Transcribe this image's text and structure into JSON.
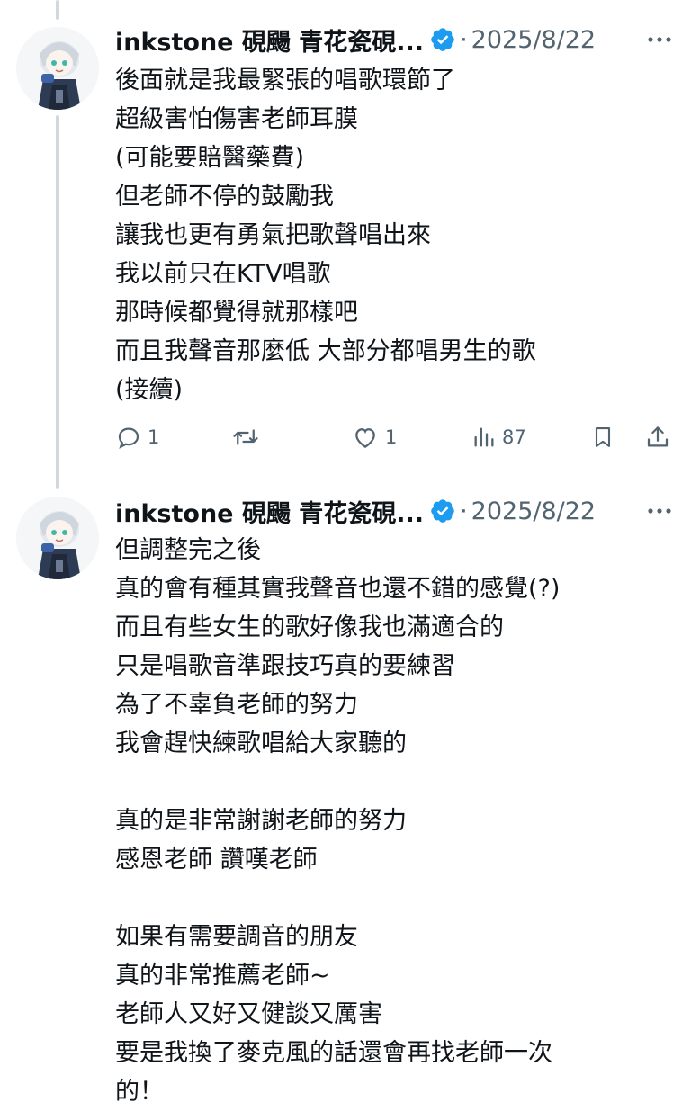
{
  "tweets": [
    {
      "name": "inkstone 硯颺 青花瓷硯...",
      "separator": "·",
      "date": "2025/8/22",
      "text": "後面就是我最緊張的唱歌環節了\n超級害怕傷害老師耳膜\n(可能要賠醫藥費)\n但老師不停的鼓勵我\n讓我也更有勇氣把歌聲唱出來\n我以前只在KTV唱歌\n那時候都覺得就那樣吧\n而且我聲音那麼低 大部分都唱男生的歌\n(接續)",
      "actions": {
        "replies": "1",
        "reposts": "",
        "likes": "1",
        "views": "87"
      }
    },
    {
      "name": "inkstone 硯颺 青花瓷硯...",
      "separator": "·",
      "date": "2025/8/22",
      "text": "但調整完之後\n真的會有種其實我聲音也還不錯的感覺(?)\n而且有些女生的歌好像我也滿適合的\n只是唱歌音準跟技巧真的要練習\n為了不辜負老師的努力\n我會趕快練歌唱給大家聽的\n\n真的是非常謝謝老師的努力\n感恩老師 讚嘆老師\n\n如果有需要調音的朋友\n真的非常推薦老師~\n老師人又好又健談又厲害\n要是我換了麥克風的話還會再找老師一次\n的！"
    }
  ],
  "colors": {
    "text": "#0f1419",
    "secondary": "#536471",
    "verified": "#1d9bf0",
    "thread_line": "#cfd9de"
  },
  "icons": [
    "reply-icon",
    "repost-icon",
    "like-icon",
    "views-icon",
    "bookmark-icon",
    "share-icon",
    "more-icon",
    "verified-badge-icon"
  ]
}
